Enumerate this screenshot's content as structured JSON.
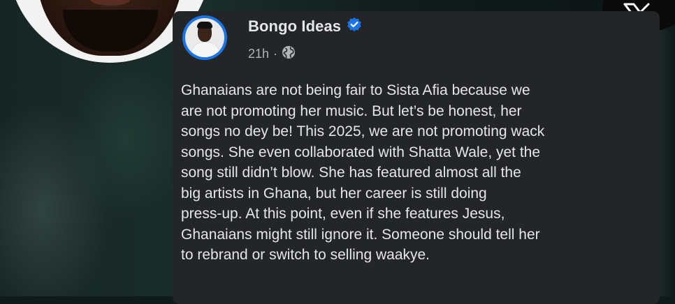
{
  "post": {
    "author": "Bongo Ideas",
    "verified_icon": "verified-badge-icon",
    "time": "21h",
    "separator": "·",
    "privacy_icon": "globe-icon",
    "text_lines": [
      "Ghanaians are not being fair to Sista Afia because we",
      "are not promoting her music. But let’s be honest, her",
      "songs no dey be! This 2025, we are not promoting wack",
      "songs. She even collaborated with Shatta Wale, yet the",
      "song still didn’t blow. She has featured almost all the",
      "big artists in Ghana, but her career is still doing",
      "press-up. At this point, even if she features Jesus,",
      "Ghanaians might still ignore it. Someone should tell her",
      "to rebrand or switch to selling waakye."
    ]
  },
  "brand": {
    "icon": "x-logo-icon"
  },
  "colors": {
    "card_bg": "#242526",
    "text_primary": "#e4e6eb",
    "text_secondary": "#b0b3b8",
    "verified_blue": "#1b74e4"
  }
}
